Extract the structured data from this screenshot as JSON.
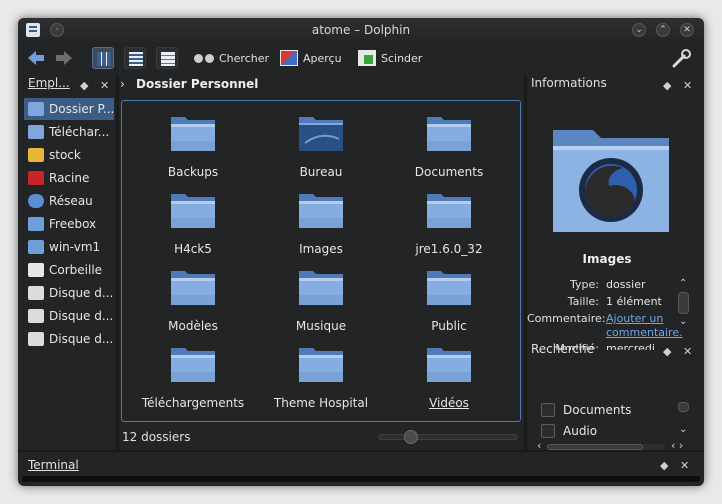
{
  "window": {
    "title": "atome – Dolphin"
  },
  "toolbar": {
    "search_label": "Chercher",
    "preview_label": "Aperçu",
    "split_label": "Scinder"
  },
  "places": {
    "header": "Empl...",
    "items": [
      {
        "label": "Dossier P...",
        "icon": "home-folder-icon",
        "selected": true
      },
      {
        "label": "Téléchar...",
        "icon": "download-folder-icon"
      },
      {
        "label": "stock",
        "icon": "folder-icon"
      },
      {
        "label": "Racine",
        "icon": "root-folder-icon"
      },
      {
        "label": "Réseau",
        "icon": "network-icon"
      },
      {
        "label": "Freebox",
        "icon": "network-share-icon"
      },
      {
        "label": "win-vm1",
        "icon": "network-share-icon"
      },
      {
        "label": "Corbeille",
        "icon": "trash-icon"
      },
      {
        "label": "Disque d...",
        "icon": "disk-icon"
      },
      {
        "label": "Disque d...",
        "icon": "disk-icon"
      },
      {
        "label": "Disque d...",
        "icon": "disk-icon"
      }
    ]
  },
  "location": {
    "breadcrumb": "Dossier Personnel"
  },
  "folders": [
    "Backups",
    "Bureau",
    "Documents",
    "H4ck5",
    "Images",
    "jre1.6.0_32",
    "Modèles",
    "Musique",
    "Public",
    "Téléchargements",
    "Theme Hospital",
    "Vidéos"
  ],
  "status": {
    "count": "12 dossiers",
    "zoom_level": 0.2
  },
  "info": {
    "header": "Informations",
    "name": "Images",
    "type_key": "Type:",
    "type_val": "dossier",
    "size_key": "Taille:",
    "size_val": "1 élément",
    "comment_key": "Commentaire:",
    "comment_val_1": "Ajouter un",
    "comment_val_2": "commentaire.",
    "modified_key": "Modifié:",
    "modified_val": "mercredi"
  },
  "search": {
    "header": "Recherche",
    "options": [
      "Documents",
      "Audio"
    ]
  },
  "terminal": {
    "header": "Terminal"
  },
  "colors": {
    "accent": "#4d7ab0",
    "selection": "#3b5c84",
    "folder": "#7fa7dd"
  }
}
